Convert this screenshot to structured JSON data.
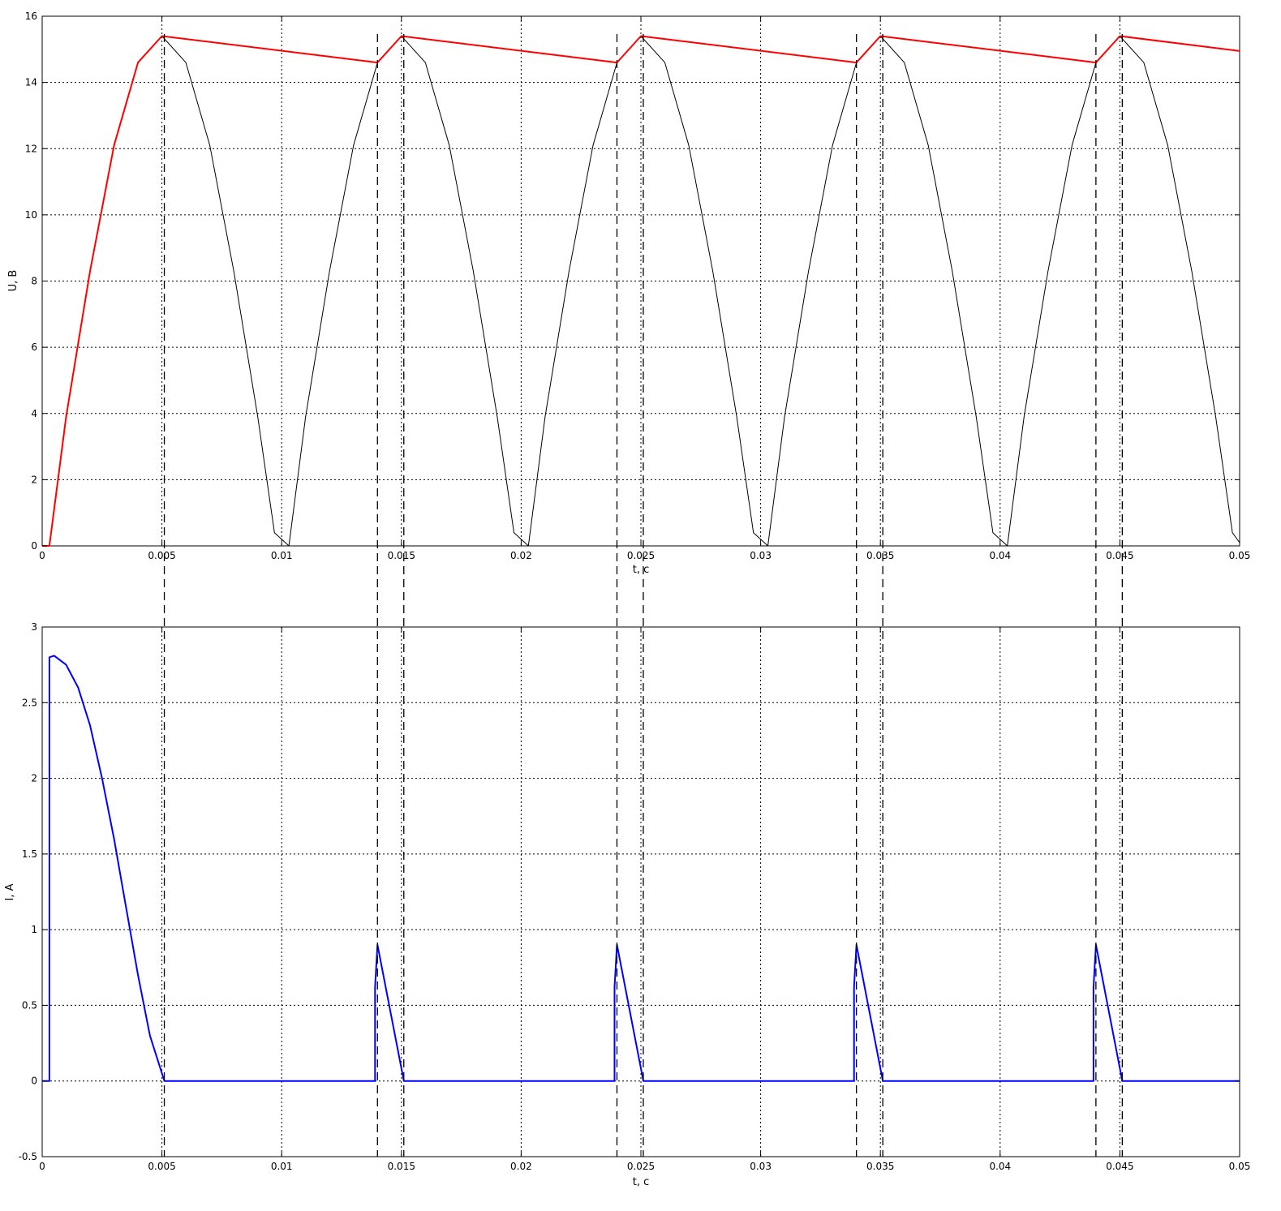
{
  "chart_data": [
    {
      "type": "line",
      "xlabel": "t, c",
      "ylabel": "U, B",
      "xlim": [
        0,
        0.05
      ],
      "ylim": [
        0,
        16
      ],
      "grid": true,
      "x_ticks": [
        "0",
        "0.005",
        "0.01",
        "0.015",
        "0.02",
        "0.025",
        "0.03",
        "0.035",
        "0.04",
        "0.045",
        "0.05"
      ],
      "y_ticks": [
        "0",
        "2",
        "4",
        "6",
        "8",
        "10",
        "12",
        "14",
        "16"
      ],
      "series": [
        {
          "color": "#000000",
          "x": [
            0.0003,
            0.001,
            0.002,
            0.003,
            0.004,
            0.005,
            0.006,
            0.007,
            0.008,
            0.009,
            0.0097,
            0.0103,
            0.011,
            0.012,
            0.013,
            0.014,
            0.015,
            0.016,
            0.017,
            0.018,
            0.019,
            0.0197,
            0.0203,
            0.021,
            0.022,
            0.023,
            0.024,
            0.025,
            0.026,
            0.027,
            0.028,
            0.029,
            0.0297,
            0.0303,
            0.031,
            0.032,
            0.033,
            0.034,
            0.035,
            0.036,
            0.037,
            0.038,
            0.039,
            0.0397,
            0.0403,
            0.041,
            0.042,
            0.043,
            0.044,
            0.045,
            0.046,
            0.047,
            0.048,
            0.049,
            0.0497,
            0.05
          ],
          "y": [
            0.0,
            3.9,
            8.3,
            12.1,
            14.6,
            15.4,
            14.6,
            12.1,
            8.3,
            3.9,
            0.4,
            0.0,
            3.9,
            8.3,
            12.1,
            14.6,
            15.4,
            14.6,
            12.1,
            8.3,
            3.9,
            0.4,
            0.0,
            3.9,
            8.3,
            12.1,
            14.6,
            15.4,
            14.6,
            12.1,
            8.3,
            3.9,
            0.4,
            0.0,
            3.9,
            8.3,
            12.1,
            14.6,
            15.4,
            14.6,
            12.1,
            8.3,
            3.9,
            0.4,
            0.0,
            3.9,
            8.3,
            12.1,
            14.6,
            15.4,
            14.6,
            12.1,
            8.3,
            3.9,
            0.4,
            0.1
          ]
        },
        {
          "color": "#ff0000",
          "x": [
            0.0,
            0.0003,
            0.001,
            0.002,
            0.003,
            0.004,
            0.005,
            0.014,
            0.015,
            0.024,
            0.025,
            0.034,
            0.035,
            0.044,
            0.045,
            0.05
          ],
          "y": [
            0.0,
            0.0,
            3.9,
            8.3,
            12.1,
            14.6,
            15.4,
            14.6,
            15.4,
            14.6,
            15.4,
            14.6,
            15.4,
            14.6,
            15.4,
            14.95
          ]
        }
      ]
    },
    {
      "type": "line",
      "xlabel": "t, c",
      "ylabel": "I, A",
      "xlim": [
        0,
        0.05
      ],
      "ylim": [
        -0.5,
        3
      ],
      "grid": true,
      "x_ticks": [
        "0",
        "0.005",
        "0.01",
        "0.015",
        "0.02",
        "0.025",
        "0.03",
        "0.035",
        "0.04",
        "0.045",
        "0.05"
      ],
      "y_ticks": [
        "-0.5",
        "0",
        "0.5",
        "1",
        "1.5",
        "2",
        "2.5",
        "3"
      ],
      "series": [
        {
          "color": "#0000ff",
          "x": [
            0.0,
            0.0003,
            0.0003,
            0.0005,
            0.001,
            0.0015,
            0.002,
            0.0025,
            0.003,
            0.0035,
            0.004,
            0.0045,
            0.0051,
            0.0139,
            0.0139,
            0.014,
            0.0151,
            0.0239,
            0.0239,
            0.024,
            0.0251,
            0.0339,
            0.0339,
            0.034,
            0.0351,
            0.0439,
            0.0439,
            0.044,
            0.0451,
            0.05
          ],
          "y": [
            0.0,
            0.0,
            2.8,
            2.81,
            2.75,
            2.6,
            2.35,
            2.0,
            1.6,
            1.15,
            0.7,
            0.3,
            0.0,
            0.0,
            0.62,
            0.9,
            0.0,
            0.0,
            0.62,
            0.9,
            0.0,
            0.0,
            0.62,
            0.9,
            0.0,
            0.0,
            0.62,
            0.9,
            0.0,
            0.0
          ]
        }
      ]
    }
  ],
  "markers": {
    "x": [
      0.0051,
      0.014,
      0.0151,
      0.024,
      0.0251,
      0.034,
      0.0351,
      0.044,
      0.0451
    ]
  }
}
